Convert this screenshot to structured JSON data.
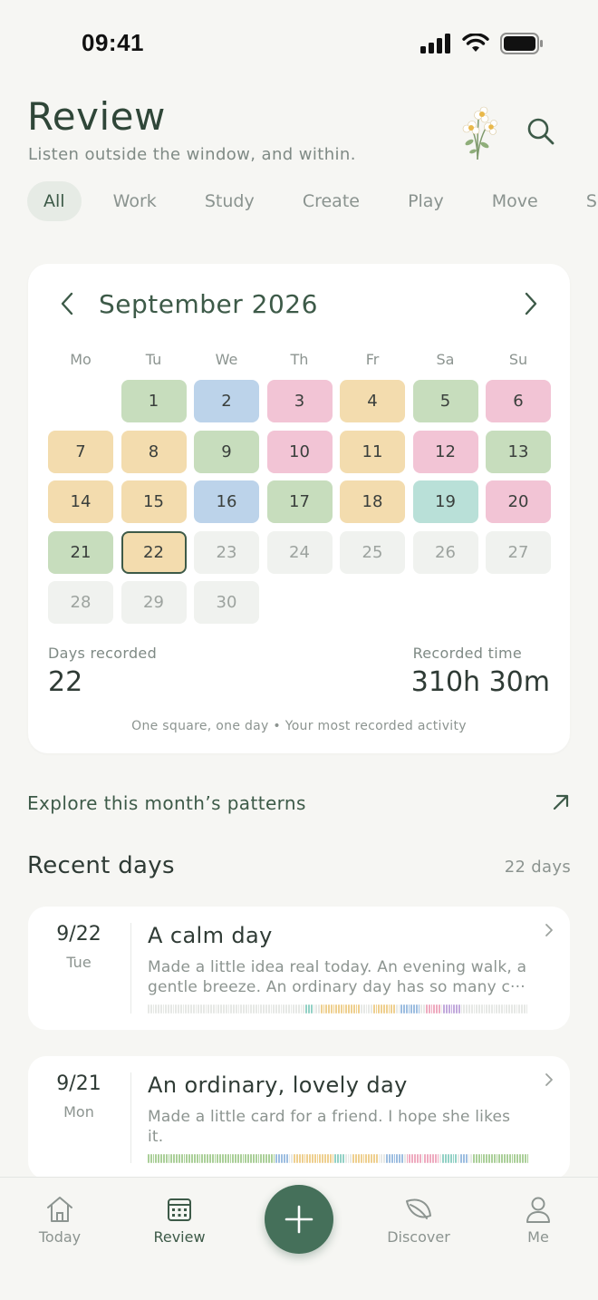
{
  "status_bar": {
    "time": "09:41"
  },
  "header": {
    "title": "Review",
    "subtitle": "Listen outside the window, and within."
  },
  "filters": [
    "All",
    "Work",
    "Study",
    "Create",
    "Play",
    "Move",
    "Social"
  ],
  "active_filter": "All",
  "colors": {
    "green": "#c7ddbd",
    "blue": "#bcd3ea",
    "pink": "#f2c4d5",
    "orange": "#f3dcae",
    "teal": "#b9e0d8",
    "empty": "#f0f2ef",
    "accent": "#45705a"
  },
  "calendar": {
    "month_label": "September 2026",
    "weekdays": [
      "Mo",
      "Tu",
      "We",
      "Th",
      "Fr",
      "Sa",
      "Su"
    ],
    "first_weekday_offset": 1,
    "today": 22,
    "days": [
      {
        "day": "1",
        "color": "green"
      },
      {
        "day": "2",
        "color": "blue"
      },
      {
        "day": "3",
        "color": "pink"
      },
      {
        "day": "4",
        "color": "orange"
      },
      {
        "day": "5",
        "color": "green"
      },
      {
        "day": "6",
        "color": "pink"
      },
      {
        "day": "7",
        "color": "orange"
      },
      {
        "day": "8",
        "color": "orange"
      },
      {
        "day": "9",
        "color": "green"
      },
      {
        "day": "10",
        "color": "pink"
      },
      {
        "day": "11",
        "color": "orange"
      },
      {
        "day": "12",
        "color": "pink"
      },
      {
        "day": "13",
        "color": "green"
      },
      {
        "day": "14",
        "color": "orange"
      },
      {
        "day": "15",
        "color": "orange"
      },
      {
        "day": "16",
        "color": "blue"
      },
      {
        "day": "17",
        "color": "green"
      },
      {
        "day": "18",
        "color": "orange"
      },
      {
        "day": "19",
        "color": "teal"
      },
      {
        "day": "20",
        "color": "pink"
      },
      {
        "day": "21",
        "color": "green"
      },
      {
        "day": "22",
        "color": "orange"
      },
      {
        "day": "23",
        "color": "empty"
      },
      {
        "day": "24",
        "color": "empty"
      },
      {
        "day": "25",
        "color": "empty"
      },
      {
        "day": "26",
        "color": "empty"
      },
      {
        "day": "27",
        "color": "empty"
      },
      {
        "day": "28",
        "color": "empty"
      },
      {
        "day": "29",
        "color": "empty"
      },
      {
        "day": "30",
        "color": "empty"
      }
    ],
    "days_recorded_label": "Days recorded",
    "days_recorded_value": "22",
    "recorded_time_label": "Recorded time",
    "recorded_time_value": "310h 30m",
    "caption": "One square, one day • Your most recorded activity"
  },
  "explore": {
    "label": "Explore this month’s patterns"
  },
  "recent": {
    "title": "Recent days",
    "count": "22 days",
    "entries": [
      {
        "date": "9/22",
        "weekday": "Tue",
        "title": "A calm day",
        "text": "Made a little idea real today. An evening walk, a gentle breeze. An ordinary day has so many c···",
        "bar": [
          "empty",
          "empty",
          "empty",
          "empty",
          "empty",
          "empty",
          "empty",
          "empty",
          "empty",
          "empty",
          "empty",
          "empty",
          "empty",
          "empty",
          "empty",
          "empty",
          "empty",
          "empty",
          "empty",
          "empty",
          "empty",
          "empty",
          "empty",
          "empty",
          "empty",
          "empty",
          "empty",
          "empty",
          "empty",
          "empty",
          "empty",
          "empty",
          "empty",
          "empty",
          "empty",
          "empty",
          "empty",
          "empty",
          "empty",
          "empty",
          "empty",
          "empty",
          "empty",
          "empty",
          "empty",
          "empty",
          "empty",
          "empty",
          "empty",
          "empty",
          "empty",
          "empty",
          "empty",
          "empty",
          "empty",
          "empty",
          "empty",
          "empty",
          "empty",
          "empty",
          "empty",
          "empty",
          "empty",
          "teal",
          "teal",
          "teal",
          "empty",
          "empty",
          "empty",
          "orange",
          "orange",
          "orange",
          "orange",
          "orange",
          "orange",
          "orange",
          "orange",
          "orange",
          "orange",
          "orange",
          "orange",
          "orange",
          "orange",
          "orange",
          "orange",
          "empty",
          "empty",
          "empty",
          "empty",
          "empty",
          "orange",
          "orange",
          "orange",
          "orange",
          "orange",
          "orange",
          "orange",
          "orange",
          "orange",
          "empty",
          "empty",
          "blue",
          "blue",
          "blue",
          "blue",
          "blue",
          "blue",
          "blue",
          "blue",
          "empty",
          "empty",
          "pink",
          "pink",
          "pink",
          "pink",
          "pink",
          "pink",
          "empty",
          "purple",
          "purple",
          "purple",
          "purple",
          "purple",
          "purple",
          "purple",
          "empty",
          "empty",
          "empty",
          "empty",
          "empty",
          "empty",
          "empty",
          "empty",
          "empty",
          "empty",
          "empty",
          "empty",
          "empty",
          "empty",
          "empty",
          "empty",
          "empty",
          "empty",
          "empty",
          "empty",
          "empty",
          "empty",
          "empty",
          "empty",
          "empty",
          "empty",
          "empty"
        ]
      },
      {
        "date": "9/21",
        "weekday": "Mon",
        "title": "An ordinary, lovely day",
        "text": "Made a little card for a friend. I hope she likes it.",
        "bar": [
          "green",
          "green",
          "green",
          "green",
          "green",
          "green",
          "green",
          "green",
          "green",
          "green",
          "green",
          "green",
          "green",
          "green",
          "green",
          "green",
          "green",
          "green",
          "green",
          "green",
          "green",
          "green",
          "green",
          "green",
          "green",
          "green",
          "green",
          "green",
          "green",
          "green",
          "green",
          "green",
          "green",
          "green",
          "green",
          "green",
          "green",
          "green",
          "green",
          "green",
          "green",
          "green",
          "green",
          "green",
          "green",
          "green",
          "green",
          "green",
          "green",
          "green",
          "blue",
          "blue",
          "blue",
          "blue",
          "blue",
          "empty",
          "empty",
          "orange",
          "orange",
          "orange",
          "orange",
          "orange",
          "orange",
          "orange",
          "orange",
          "orange",
          "orange",
          "orange",
          "orange",
          "orange",
          "orange",
          "orange",
          "orange",
          "teal",
          "teal",
          "teal",
          "teal",
          "empty",
          "empty",
          "empty",
          "orange",
          "orange",
          "orange",
          "orange",
          "orange",
          "orange",
          "orange",
          "orange",
          "orange",
          "orange",
          "empty",
          "empty",
          "empty",
          "blue",
          "blue",
          "blue",
          "blue",
          "blue",
          "blue",
          "blue",
          "empty",
          "pink",
          "pink",
          "pink",
          "pink",
          "pink",
          "pink",
          "empty",
          "pink",
          "pink",
          "pink",
          "pink",
          "pink",
          "pink",
          "empty",
          "teal",
          "teal",
          "teal",
          "teal",
          "teal",
          "teal",
          "empty",
          "blue",
          "blue",
          "blue",
          "empty",
          "empty",
          "green",
          "green",
          "green",
          "green",
          "green",
          "green",
          "green",
          "green",
          "green",
          "green",
          "green",
          "green",
          "green",
          "green",
          "green",
          "green",
          "green",
          "green",
          "green",
          "green",
          "green",
          "green"
        ]
      }
    ]
  },
  "bar_colors": {
    "empty": "#e6e8e5",
    "green": "#aacf98",
    "blue": "#9cbde0",
    "pink": "#eeaabf",
    "orange": "#eecf8e",
    "teal": "#92d1c5",
    "purple": "#c2a9dc"
  },
  "nav": {
    "items": [
      {
        "label": "Today",
        "icon": "home-icon"
      },
      {
        "label": "Review",
        "icon": "calendar-icon"
      },
      {
        "label": "Discover",
        "icon": "leaf-icon"
      },
      {
        "label": "Me",
        "icon": "person-icon"
      }
    ],
    "active": "Review"
  }
}
